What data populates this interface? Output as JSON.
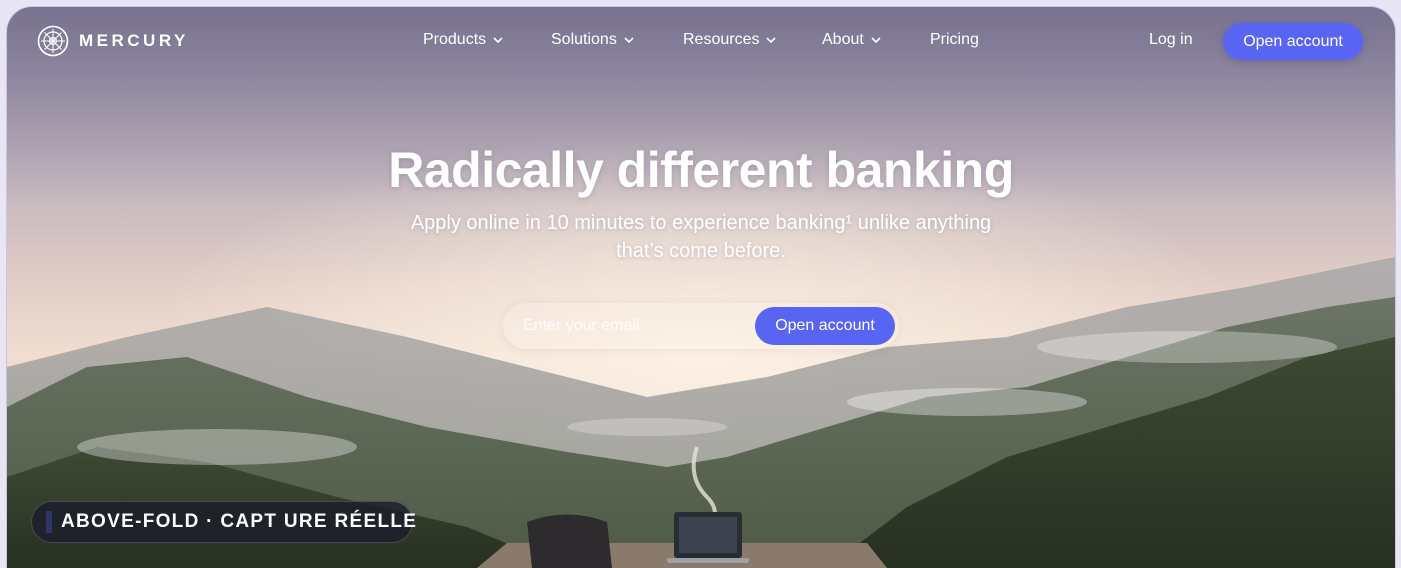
{
  "brand": {
    "name": "MERCURY"
  },
  "nav": {
    "items": [
      {
        "label": "Products",
        "has_dropdown": true
      },
      {
        "label": "Solutions",
        "has_dropdown": true
      },
      {
        "label": "Resources",
        "has_dropdown": true
      },
      {
        "label": "About",
        "has_dropdown": true
      },
      {
        "label": "Pricing",
        "has_dropdown": false
      }
    ],
    "login_label": "Log in",
    "cta_label": "Open account"
  },
  "hero": {
    "title": "Radically different banking",
    "subtitle": "Apply online in 10 minutes to experience banking¹ unlike anything that’s come before.",
    "email_placeholder": "Enter your email",
    "cta_label": "Open account"
  },
  "badge": {
    "text": "ABOVE-FOLD · CAPT URE RÉELLE"
  },
  "colors": {
    "accent": "#5865f2",
    "badge_bg": "#1c1c2c",
    "text": "#ffffff"
  },
  "icons": {
    "logo": "mercury-logo-icon",
    "dropdown": "chevron-down-icon",
    "status": "status-dot-icon"
  }
}
